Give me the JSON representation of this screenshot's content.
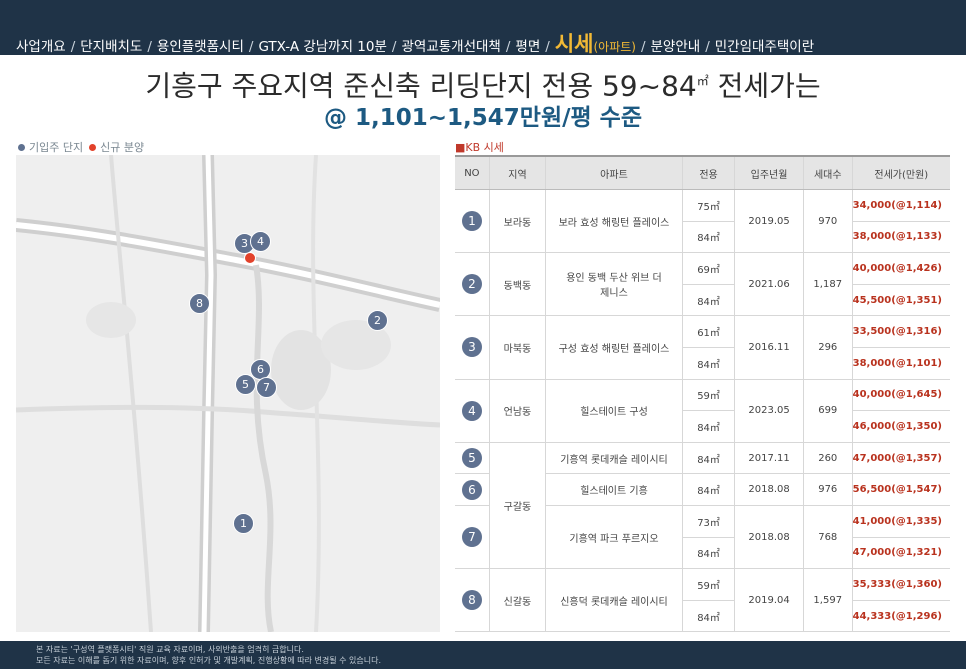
{
  "nav": {
    "items": [
      "사업개요",
      "단지배치도",
      "용인플랫폼시티",
      "GTX-A 강남까지 10분",
      "광역교통개선대책",
      "평면"
    ],
    "active_main": "시세",
    "active_sub": "(아파트)",
    "after": [
      "분양안내",
      "민간임대주택이란"
    ]
  },
  "headline": {
    "main": "기흥구 주요지역 준신축 리딩단지 전용 59~84",
    "unit": "㎡",
    "tail": "전세가는"
  },
  "subheadline": "@ 1,101~1,547만원/평 수준",
  "legend": {
    "existing": "기입주 단지",
    "new": "신규 분양",
    "existing_color": "#5f7190",
    "new_color": "#e2412a"
  },
  "map_markers": [
    "1",
    "2",
    "3",
    "4",
    "5",
    "6",
    "7",
    "8"
  ],
  "kb_label": {
    "box": "■",
    "text": "KB 시세"
  },
  "table": {
    "headers": [
      "NO",
      "지역",
      "아파트",
      "전용",
      "입주년월",
      "세대수",
      "전세가(만원)"
    ],
    "complexes": [
      {
        "no": "1",
        "region": "보라동",
        "name": "보라 효성 해링턴 플레이스",
        "date": "2019.05",
        "units": "970",
        "rows": [
          {
            "area": "75㎡",
            "price": "34,000(@1,114)"
          },
          {
            "area": "84㎡",
            "price": "38,000(@1,133)"
          }
        ]
      },
      {
        "no": "2",
        "region": "동백동",
        "name": "용인 동백 두산 위브 더 제니스",
        "date": "2021.06",
        "units": "1,187",
        "rows": [
          {
            "area": "69㎡",
            "price": "40,000(@1,426)"
          },
          {
            "area": "84㎡",
            "price": "45,500(@1,351)"
          }
        ]
      },
      {
        "no": "3",
        "region": "마북동",
        "name": "구성 효성 해링턴 플레이스",
        "date": "2016.11",
        "units": "296",
        "rows": [
          {
            "area": "61㎡",
            "price": "33,500(@1,316)"
          },
          {
            "area": "84㎡",
            "price": "38,000(@1,101)"
          }
        ]
      },
      {
        "no": "4",
        "region": "언남동",
        "name": "힐스테이트 구성",
        "date": "2023.05",
        "units": "699",
        "rows": [
          {
            "area": "59㎡",
            "price": "40,000(@1,645)"
          },
          {
            "area": "84㎡",
            "price": "46,000(@1,350)"
          }
        ]
      },
      {
        "no": "5",
        "region": "구갈동",
        "name": "기흥역 롯데캐슬 레이시티",
        "date": "2017.11",
        "units": "260",
        "rows": [
          {
            "area": "84㎡",
            "price": "47,000(@1,357)"
          }
        ]
      },
      {
        "no": "6",
        "region": "구갈동",
        "name": "힐스테이트 기흥",
        "date": "2018.08",
        "units": "976",
        "rows": [
          {
            "area": "84㎡",
            "price": "56,500(@1,547)"
          }
        ]
      },
      {
        "no": "7",
        "region": "구갈동",
        "name": "기흥역 파크 푸르지오",
        "date": "2018.08",
        "units": "768",
        "rows": [
          {
            "area": "73㎡",
            "price": "41,000(@1,335)"
          },
          {
            "area": "84㎡",
            "price": "47,000(@1,321)"
          }
        ]
      },
      {
        "no": "8",
        "region": "신갈동",
        "name": "신흥덕 롯데캐슬 레이시티",
        "date": "2019.04",
        "units": "1,597",
        "rows": [
          {
            "area": "59㎡",
            "price": "35,333(@1,360)"
          },
          {
            "area": "84㎡",
            "price": "44,333(@1,296)"
          }
        ]
      }
    ]
  },
  "footer": {
    "line1": "본 자료는 '구성역 플랫폼시티' 직원 교육 자료이며, 사외반출을 엄격히 금합니다.",
    "line2": "모든 자료는 이해를 돕기 위한 자료이며, 향후 인허가 및 개발계획, 진행상황에 따라 변경될 수 있습니다."
  }
}
